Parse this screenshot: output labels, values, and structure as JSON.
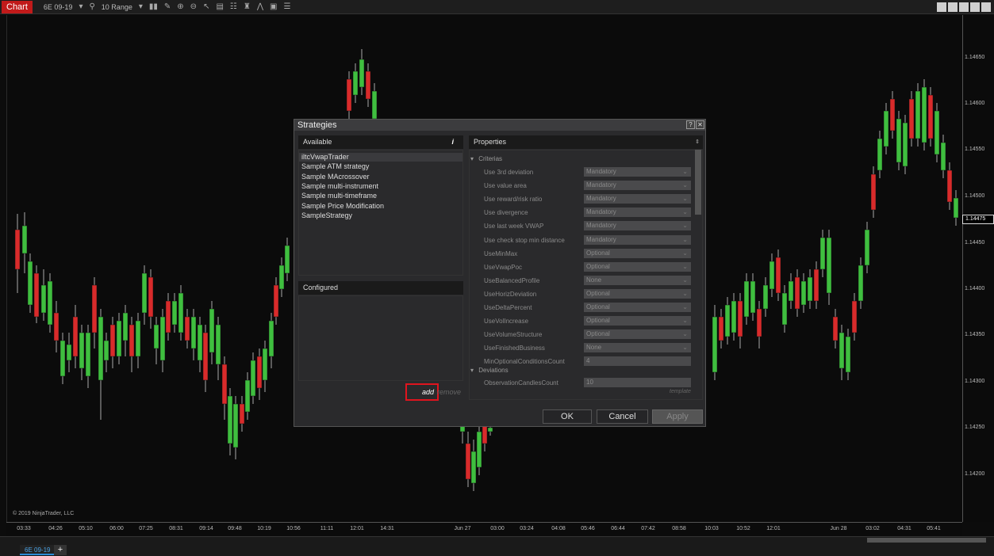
{
  "toolbar": {
    "chart_label": "Chart",
    "instrument": "6E 09-19",
    "bar_type": "10 Range",
    "icons": [
      "chevron-down-icon",
      "search-icon",
      "chevron-down-icon",
      "bar-type-icon",
      "drawing-tool-icon",
      "zoom-in-icon",
      "zoom-out-icon",
      "pointer-icon",
      "data-box-icon",
      "properties-icon",
      "strategies-icon",
      "indicator-icon",
      "snapshot-icon",
      "list-icon"
    ]
  },
  "price_axis": {
    "labels": [
      "1.14650",
      "1.14600",
      "1.14550",
      "1.14500",
      "1.14450",
      "1.14400",
      "1.14350",
      "1.14300",
      "1.14250",
      "1.14200"
    ],
    "current_price": "1.14475"
  },
  "time_axis": {
    "labels": [
      "03:33",
      "04:26",
      "05:10",
      "06:00",
      "07:25",
      "08:31",
      "09:14",
      "09:48",
      "10:19",
      "10:56",
      "11:11",
      "12:01",
      "14:31",
      "Jun 27",
      "03:00",
      "03:24",
      "04:08",
      "05:46",
      "06:44",
      "07:42",
      "08:58",
      "10:03",
      "10:52",
      "12:01",
      "Jun 28",
      "03:02",
      "04:31",
      "05:41"
    ]
  },
  "copyright": "© 2019 NinjaTrader, LLC",
  "bottom_tabs": {
    "instrument_tab": "6E 09-19",
    "add_tab": "+"
  },
  "colors": {
    "up": "#3fbf3f",
    "down": "#d92b2b",
    "chart_tab": "#c11a1a",
    "highlight": "#e0141e"
  },
  "dialog": {
    "title": "Strategies",
    "help_label": "?",
    "close_label": "✕",
    "available_header": "Available",
    "info_label": "i",
    "available_items": [
      "iltcVwapTrader",
      "Sample ATM strategy",
      "Sample MAcrossover",
      "Sample multi-instrument",
      "Sample multi-timeframe",
      "Sample Price Modification",
      "SampleStrategy"
    ],
    "configured_header": "Configured",
    "add_label": "add",
    "remove_label": "remove",
    "properties_header": "Properties",
    "sections": [
      "Criterias",
      "Deviations"
    ],
    "properties": [
      {
        "name": "Use 3rd deviation",
        "value": "Mandatory"
      },
      {
        "name": "Use value area",
        "value": "Mandatory"
      },
      {
        "name": "Use reward/risk ratio",
        "value": "Mandatory"
      },
      {
        "name": "Use divergence",
        "value": "Mandatory"
      },
      {
        "name": "Use last week VWAP",
        "value": "Mandatory"
      },
      {
        "name": "Use check stop min distance",
        "value": "Mandatory"
      },
      {
        "name": "UseMinMax",
        "value": "Optional"
      },
      {
        "name": "UseVwapPoc",
        "value": "Optional"
      },
      {
        "name": "UseBalancedProfile",
        "value": "None"
      },
      {
        "name": "UseHorizDeviation",
        "value": "Optional"
      },
      {
        "name": "UseDeltaPercent",
        "value": "Optional"
      },
      {
        "name": "UseVolIncrease",
        "value": "Optional"
      },
      {
        "name": "UseVolumeStructure",
        "value": "Optional"
      },
      {
        "name": "UseFinishedBusiness",
        "value": "None"
      },
      {
        "name": "MinOptionalConditionsCount",
        "value": "4"
      }
    ],
    "deviation_property": {
      "name": "ObservationCandlesCount",
      "value": "10"
    },
    "template_label": "template",
    "ok_label": "OK",
    "cancel_label": "Cancel",
    "apply_label": "Apply"
  }
}
